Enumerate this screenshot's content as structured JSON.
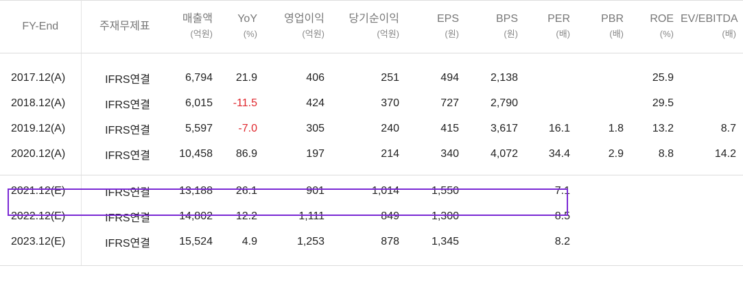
{
  "columns": [
    {
      "label": "FY-End",
      "unit": ""
    },
    {
      "label": "주재무제표",
      "unit": ""
    },
    {
      "label": "매출액",
      "unit": "(억원)"
    },
    {
      "label": "YoY",
      "unit": "(%)"
    },
    {
      "label": "영업이익",
      "unit": "(억원)"
    },
    {
      "label": "당기순이익",
      "unit": "(억원)"
    },
    {
      "label": "EPS",
      "unit": "(원)"
    },
    {
      "label": "BPS",
      "unit": "(원)"
    },
    {
      "label": "PER",
      "unit": "(배)"
    },
    {
      "label": "PBR",
      "unit": "(배)"
    },
    {
      "label": "ROE",
      "unit": "(%)"
    },
    {
      "label": "EV/EBITDA",
      "unit": "(배)"
    }
  ],
  "actual_rows": [
    {
      "fy": "2017.12(A)",
      "stmt": "IFRS연결",
      "sales": "6,794",
      "yoy": "21.9",
      "op": "406",
      "net": "251",
      "eps": "494",
      "bps": "2,138",
      "per": "",
      "pbr": "",
      "roe": "25.9",
      "ev": ""
    },
    {
      "fy": "2018.12(A)",
      "stmt": "IFRS연결",
      "sales": "6,015",
      "yoy": "-11.5",
      "op": "424",
      "net": "370",
      "eps": "727",
      "bps": "2,790",
      "per": "",
      "pbr": "",
      "roe": "29.5",
      "ev": ""
    },
    {
      "fy": "2019.12(A)",
      "stmt": "IFRS연결",
      "sales": "5,597",
      "yoy": "-7.0",
      "op": "305",
      "net": "240",
      "eps": "415",
      "bps": "3,617",
      "per": "16.1",
      "pbr": "1.8",
      "roe": "13.2",
      "ev": "8.7"
    },
    {
      "fy": "2020.12(A)",
      "stmt": "IFRS연결",
      "sales": "10,458",
      "yoy": "86.9",
      "op": "197",
      "net": "214",
      "eps": "340",
      "bps": "4,072",
      "per": "34.4",
      "pbr": "2.9",
      "roe": "8.8",
      "ev": "14.2"
    }
  ],
  "estimate_rows": [
    {
      "fy": "2021.12(E)",
      "stmt": "IFRS연결",
      "sales": "13,188",
      "yoy": "26.1",
      "op": "901",
      "net": "1,014",
      "eps": "1,550",
      "bps": "",
      "per": "7.1",
      "pbr": "",
      "roe": "",
      "ev": ""
    },
    {
      "fy": "2022.12(E)",
      "stmt": "IFRS연결",
      "sales": "14,802",
      "yoy": "12.2",
      "op": "1,111",
      "net": "849",
      "eps": "1,300",
      "bps": "",
      "per": "8.5",
      "pbr": "",
      "roe": "",
      "ev": ""
    },
    {
      "fy": "2023.12(E)",
      "stmt": "IFRS연결",
      "sales": "15,524",
      "yoy": "4.9",
      "op": "1,253",
      "net": "878",
      "eps": "1,345",
      "bps": "",
      "per": "8.2",
      "pbr": "",
      "roe": "",
      "ev": ""
    }
  ],
  "colors": {
    "negative": "#e0282e",
    "highlight_border": "#7a28d4",
    "header_text": "#777777",
    "grid_line": "#dcdcdc"
  },
  "highlighted_row": "2021.12(E)"
}
